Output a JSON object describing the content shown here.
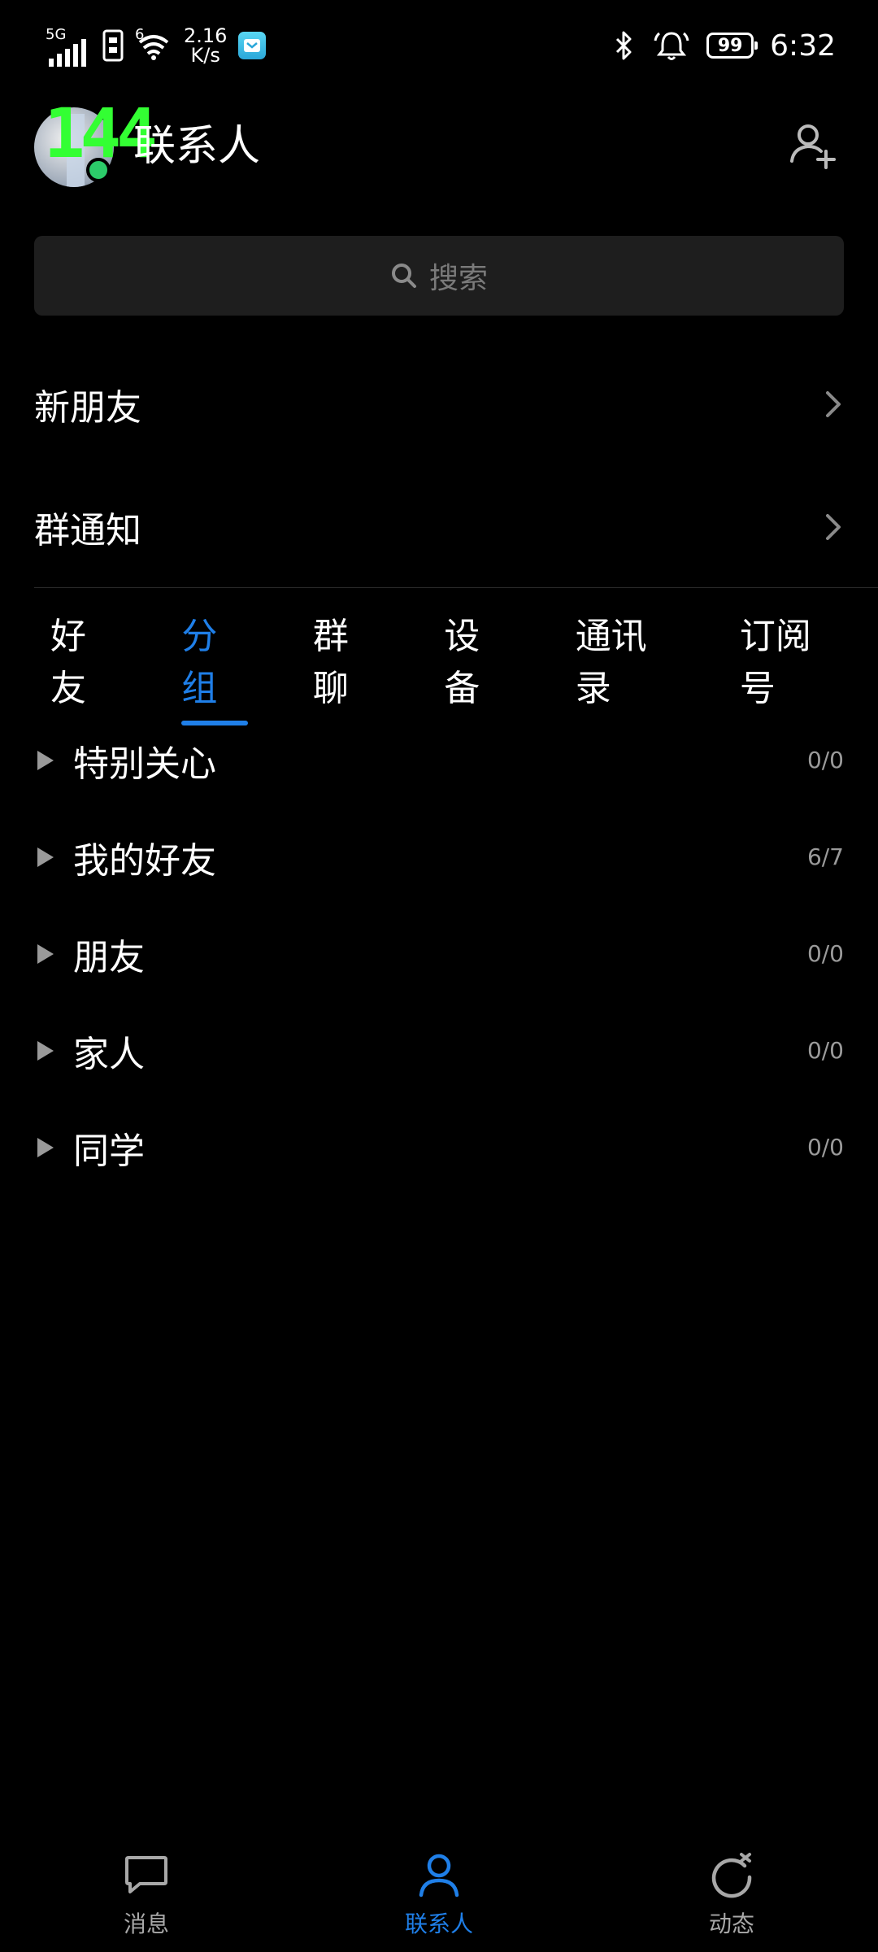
{
  "status_bar": {
    "network": "5G",
    "signal_small": "6",
    "speed_value": "2.16",
    "speed_unit": "K/s",
    "battery": "99",
    "time": "6:32"
  },
  "header": {
    "title": "联系人",
    "overlay_text": "144"
  },
  "search": {
    "placeholder": "搜索"
  },
  "entries": [
    {
      "label": "新朋友"
    },
    {
      "label": "群通知"
    }
  ],
  "tabs": [
    {
      "label": "好友",
      "active": false
    },
    {
      "label": "分组",
      "active": true
    },
    {
      "label": "群聊",
      "active": false
    },
    {
      "label": "设备",
      "active": false
    },
    {
      "label": "通讯录",
      "active": false
    },
    {
      "label": "订阅号",
      "active": false
    }
  ],
  "groups": [
    {
      "name": "特别关心",
      "count": "0/0"
    },
    {
      "name": "我的好友",
      "count": "6/7"
    },
    {
      "name": "朋友",
      "count": "0/0"
    },
    {
      "name": "家人",
      "count": "0/0"
    },
    {
      "name": "同学",
      "count": "0/0"
    }
  ],
  "bottom_nav": [
    {
      "label": "消息",
      "icon": "message-icon",
      "active": false
    },
    {
      "label": "联系人",
      "icon": "contacts-icon",
      "active": true
    },
    {
      "label": "动态",
      "icon": "refresh-star-icon",
      "active": false
    }
  ],
  "colors": {
    "accent": "#1f7fe8",
    "online": "#2ccc6a",
    "overlay": "#33ff33"
  }
}
